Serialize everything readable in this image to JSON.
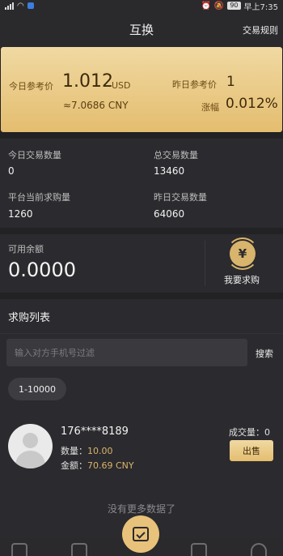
{
  "status_bar": {
    "battery": "90",
    "time": "早上7:35"
  },
  "header": {
    "title": "互换",
    "rules": "交易规则"
  },
  "price_card": {
    "today_label": "今日参考价",
    "today_price": "1.012",
    "today_unit": "USD",
    "today_cny": "≈7.0686 CNY",
    "yesterday_label": "昨日参考价",
    "yesterday_price": "1",
    "change_label": "涨幅",
    "change_value": "0.012%"
  },
  "stats": {
    "today_volume_label": "今日交易数量",
    "today_volume": "0",
    "total_volume_label": "总交易数量",
    "total_volume": "13460",
    "platform_buy_label": "平台当前求购量",
    "platform_buy": "1260",
    "yesterday_volume_label": "昨日交易数量",
    "yesterday_volume": "64060"
  },
  "balance": {
    "label": "可用余额",
    "value": "0.0000",
    "buy_label": "我要求购",
    "icon": "yen-icon"
  },
  "list": {
    "title": "求购列表",
    "search_placeholder": "输入对方手机号过滤",
    "search_label": "搜索",
    "range": "1-10000",
    "orders": [
      {
        "phone": "176****8189",
        "qty_label": "数量：",
        "qty": "10.00",
        "amount_label": "金额：",
        "amount": "70.69 CNY",
        "deal_label": "成交量：",
        "deal": "0",
        "sell_label": "出售"
      }
    ],
    "no_more": "没有更多数据了"
  },
  "colors": {
    "accent": "#e4bd6f",
    "background": "#222124",
    "panel": "#2b2a2e"
  }
}
